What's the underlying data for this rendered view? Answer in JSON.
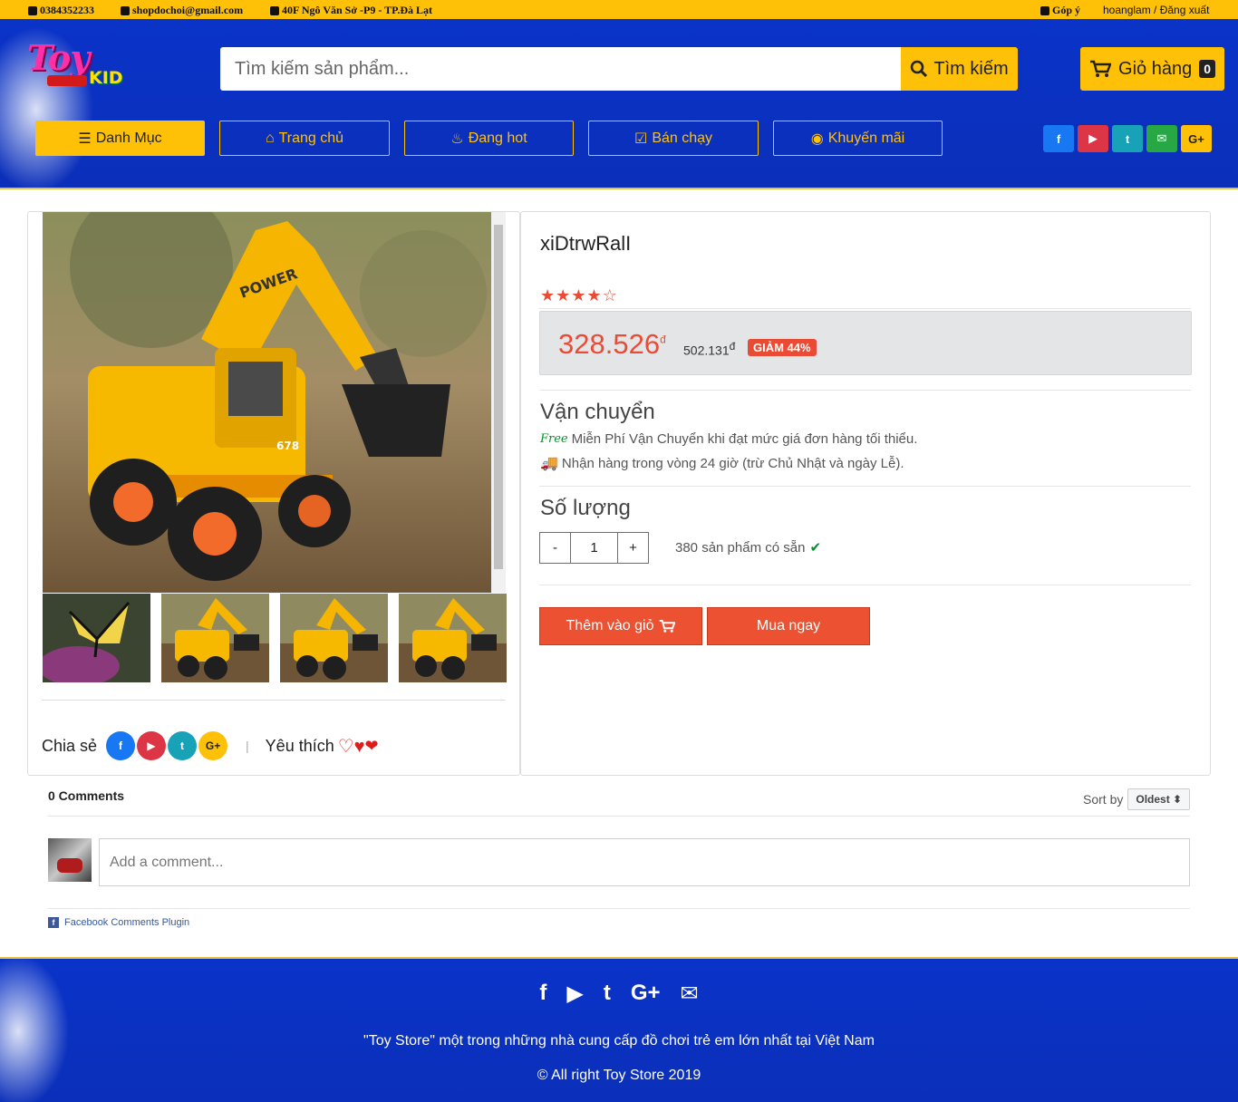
{
  "topbar": {
    "phone": "0384352233",
    "email": "shopdochoi@gmail.com",
    "address": "40F Ngô Văn Sở -P9 - TP.Đà Lạt",
    "feedback": "Góp ý",
    "user": "hoanglam / Đăng xuất"
  },
  "header": {
    "logo_top": "Toy",
    "logo_bottom": "KID",
    "search_placeholder": "Tìm kiếm sản phẩm...",
    "search_button": "Tìm kiếm",
    "cart_label": "Giỏ hàng",
    "cart_count": "0"
  },
  "nav": [
    {
      "label": "Danh Mục",
      "icon": "list-icon"
    },
    {
      "label": "Trang chủ",
      "icon": "home-icon"
    },
    {
      "label": "Đang hot",
      "icon": "fire-icon"
    },
    {
      "label": "Bán chạy",
      "icon": "check-square-icon"
    },
    {
      "label": "Khuyến mãi",
      "icon": "chrome-icon"
    }
  ],
  "social": [
    {
      "name": "facebook-icon",
      "glyph": "f",
      "color": "#1877f2"
    },
    {
      "name": "youtube-icon",
      "glyph": "▶",
      "color": "#dc3545"
    },
    {
      "name": "twitter-icon",
      "glyph": "t",
      "color": "#17a2b8"
    },
    {
      "name": "email-icon",
      "glyph": "✉",
      "color": "#28a745"
    },
    {
      "name": "google-plus-icon",
      "glyph": "G+",
      "color": "#ffc107"
    }
  ],
  "product": {
    "title": "xiDtrwRalI",
    "rating": 4.5,
    "price": "328.526",
    "currency": "đ",
    "old_price": "502.131",
    "discount": "GIẢM 44%",
    "shipping_title": "Vận chuyển",
    "free_label": "Free",
    "shipping_free": "Miễn Phí Vận Chuyển khi đạt mức giá đơn hàng tối thiểu.",
    "shipping_time": "Nhận hàng trong vòng 24 giờ (trừ Chủ Nhật và ngày Lễ).",
    "quantity_title": "Số lượng",
    "qty_minus": "-",
    "qty_value": "1",
    "qty_plus": "+",
    "stock": "380 sản phẩm có sẵn",
    "add_to_cart": "Thêm vào giỏ",
    "buy_now": "Mua ngay"
  },
  "gallery": {
    "share_label": "Chia sẻ",
    "like_label": "Yêu thích",
    "separator": "|",
    "main_badge": "POWER",
    "model_badge": "678"
  },
  "comments": {
    "count": "0 Comments",
    "sort_label": "Sort by",
    "sort_value": "Oldest",
    "placeholder": "Add a comment...",
    "plugin": "Facebook Comments Plugin"
  },
  "footer": {
    "tagline": "\"Toy Store\" một trong những nhà cung cấp đồ chơi trẻ em lớn nhất tại Việt Nam",
    "copyright": "© All right Toy Store 2019"
  }
}
